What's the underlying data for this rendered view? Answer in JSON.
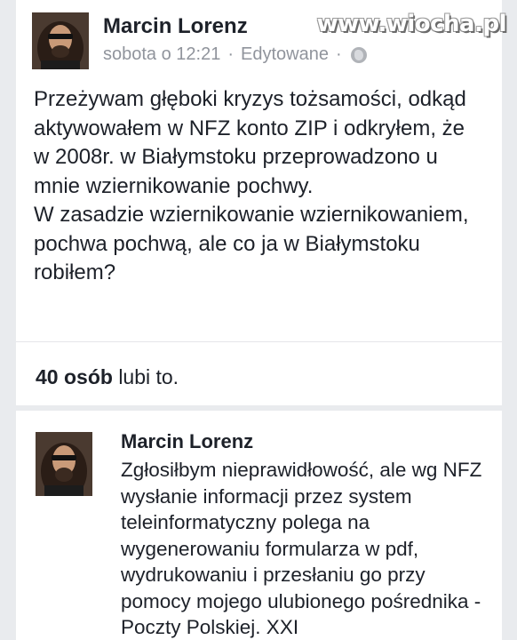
{
  "watermark": "www.wiocha.pl",
  "post": {
    "author": "Marcin Lorenz",
    "timestamp": "sobota o 12:21",
    "separator": "·",
    "edited_label": "Edytowane",
    "separator2": "·",
    "audience_icon": "globe-icon",
    "paragraphs": [
      "Przeżywam głęboki kryzys tożsamości, odkąd aktywowałem w NFZ konto ZIP i odkryłem, że w 2008r. w Białymstoku przeprowadzono u mnie wziernikowanie pochwy.",
      "W zasadzie wziernikowanie wziernikowaniem, pochwa pochwą, ale co ja w Białymstoku robiłem?"
    ],
    "likes_count": "40 osób",
    "likes_suffix": "lubi to."
  },
  "comment": {
    "author": "Marcin Lorenz",
    "text": "Zgłosiłbym nieprawidłowość, ale wg NFZ wysłanie informacji przez system teleinformatyczny polega na wygenerowaniu formularza w pdf, wydrukowaniu i przesłaniu go przy pomocy mojego ulubionego pośrednika - Poczty Polskiej. XXI"
  },
  "colors": {
    "background": "#e9ebee",
    "card": "#ffffff",
    "text": "#1d2129",
    "meta": "#90949c"
  }
}
